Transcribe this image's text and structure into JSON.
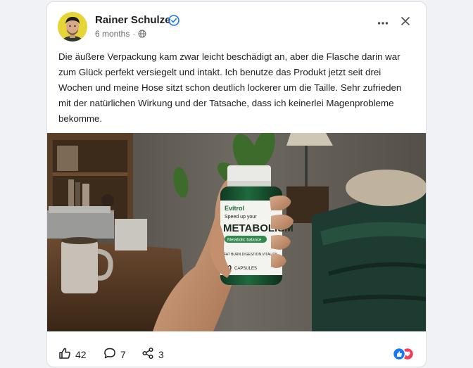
{
  "post": {
    "author": {
      "name": "Rainer Schulze",
      "verified": true
    },
    "time": "6 months",
    "separator": "·",
    "privacy_icon": "globe-icon",
    "text": "Die äußere Verpackung kam zwar leicht beschädigt an, aber die Flasche darin war zum Glück perfekt versiegelt und intakt. Ich benutze das Produkt jetzt seit drei Wochen und meine Hose sitzt schon deutlich lockerer um die Taille. Sehr zufrieden mit der natürlichen Wirkung und der Tatsache, dass ich keinerlei Magenprobleme bekomme.",
    "image": {
      "brand": "Evitrol",
      "tagline": "Speed up your",
      "product": "METABOLISM",
      "badge": "Metabolic balance",
      "benefits": [
        "FAT BURN",
        "DIGESTION",
        "VITALITY"
      ],
      "count": "30",
      "count_unit": "CAPSULES",
      "subtext": "Dietary Supplement"
    },
    "stats": {
      "likes": "42",
      "comments": "7",
      "shares": "3"
    },
    "icons": {
      "like": "thumbs-up-icon",
      "comment": "comment-icon",
      "share": "share-icon",
      "more": "more-horizontal-icon",
      "close": "close-icon",
      "verified": "verified-badge-icon"
    },
    "colors": {
      "accent": "#1877f2",
      "like_reaction": "#1877f2",
      "love_reaction": "#f33e58"
    }
  }
}
